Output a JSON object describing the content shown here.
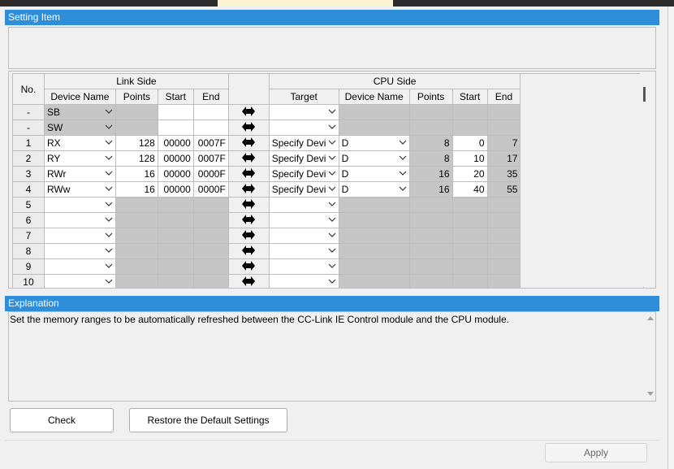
{
  "setting_item": {
    "title": "Setting Item"
  },
  "grid": {
    "headers": {
      "no": "No.",
      "link_side": "Link Side",
      "cpu_side": "CPU Side",
      "link_device_name": "Device Name",
      "link_points": "Points",
      "link_start": "Start",
      "link_end": "End",
      "target": "Target",
      "cpu_device_name": "Device Name",
      "cpu_points": "Points",
      "cpu_start": "Start",
      "cpu_end": "End"
    },
    "rows": [
      {
        "no": "-",
        "link_device": "SB",
        "link_points": "",
        "link_start": "",
        "link_end": "",
        "target": "",
        "cpu_device": "",
        "cpu_points": "",
        "cpu_start": "",
        "cpu_end": ""
      },
      {
        "no": "-",
        "link_device": "SW",
        "link_points": "",
        "link_start": "",
        "link_end": "",
        "target": "",
        "cpu_device": "",
        "cpu_points": "",
        "cpu_start": "",
        "cpu_end": ""
      },
      {
        "no": "1",
        "link_device": "RX",
        "link_points": "128",
        "link_start": "00000",
        "link_end": "0007F",
        "target": "Specify Devi",
        "cpu_device": "D",
        "cpu_points": "8",
        "cpu_start": "0",
        "cpu_end": "7"
      },
      {
        "no": "2",
        "link_device": "RY",
        "link_points": "128",
        "link_start": "00000",
        "link_end": "0007F",
        "target": "Specify Devi",
        "cpu_device": "D",
        "cpu_points": "8",
        "cpu_start": "10",
        "cpu_end": "17"
      },
      {
        "no": "3",
        "link_device": "RWr",
        "link_points": "16",
        "link_start": "00000",
        "link_end": "0000F",
        "target": "Specify Devi",
        "cpu_device": "D",
        "cpu_points": "16",
        "cpu_start": "20",
        "cpu_end": "35"
      },
      {
        "no": "4",
        "link_device": "RWw",
        "link_points": "16",
        "link_start": "00000",
        "link_end": "0000F",
        "target": "Specify Devi",
        "cpu_device": "D",
        "cpu_points": "16",
        "cpu_start": "40",
        "cpu_end": "55"
      },
      {
        "no": "5",
        "link_device": "",
        "link_points": "",
        "link_start": "",
        "link_end": "",
        "target": "",
        "cpu_device": "",
        "cpu_points": "",
        "cpu_start": "",
        "cpu_end": ""
      },
      {
        "no": "6",
        "link_device": "",
        "link_points": "",
        "link_start": "",
        "link_end": "",
        "target": "",
        "cpu_device": "",
        "cpu_points": "",
        "cpu_start": "",
        "cpu_end": ""
      },
      {
        "no": "7",
        "link_device": "",
        "link_points": "",
        "link_start": "",
        "link_end": "",
        "target": "",
        "cpu_device": "",
        "cpu_points": "",
        "cpu_start": "",
        "cpu_end": ""
      },
      {
        "no": "8",
        "link_device": "",
        "link_points": "",
        "link_start": "",
        "link_end": "",
        "target": "",
        "cpu_device": "",
        "cpu_points": "",
        "cpu_start": "",
        "cpu_end": ""
      },
      {
        "no": "9",
        "link_device": "",
        "link_points": "",
        "link_start": "",
        "link_end": "",
        "target": "",
        "cpu_device": "",
        "cpu_points": "",
        "cpu_start": "",
        "cpu_end": ""
      },
      {
        "no": "10",
        "link_device": "",
        "link_points": "",
        "link_start": "",
        "link_end": "",
        "target": "",
        "cpu_device": "",
        "cpu_points": "",
        "cpu_start": "",
        "cpu_end": ""
      }
    ]
  },
  "explanation": {
    "title": "Explanation",
    "text": "Set the memory ranges to be automatically refreshed between the CC-Link IE Control module and the CPU module."
  },
  "buttons": {
    "check": "Check",
    "restore": "Restore the Default Settings",
    "apply": "Apply"
  },
  "colors": {
    "accent": "#2e8ed9",
    "disabled_cell": "#c6c6c6",
    "empty_area": "#a6a6a6"
  },
  "icons": {
    "dropdown": "chevron-down-icon",
    "transfer": "bidirectional-arrow-icon"
  }
}
